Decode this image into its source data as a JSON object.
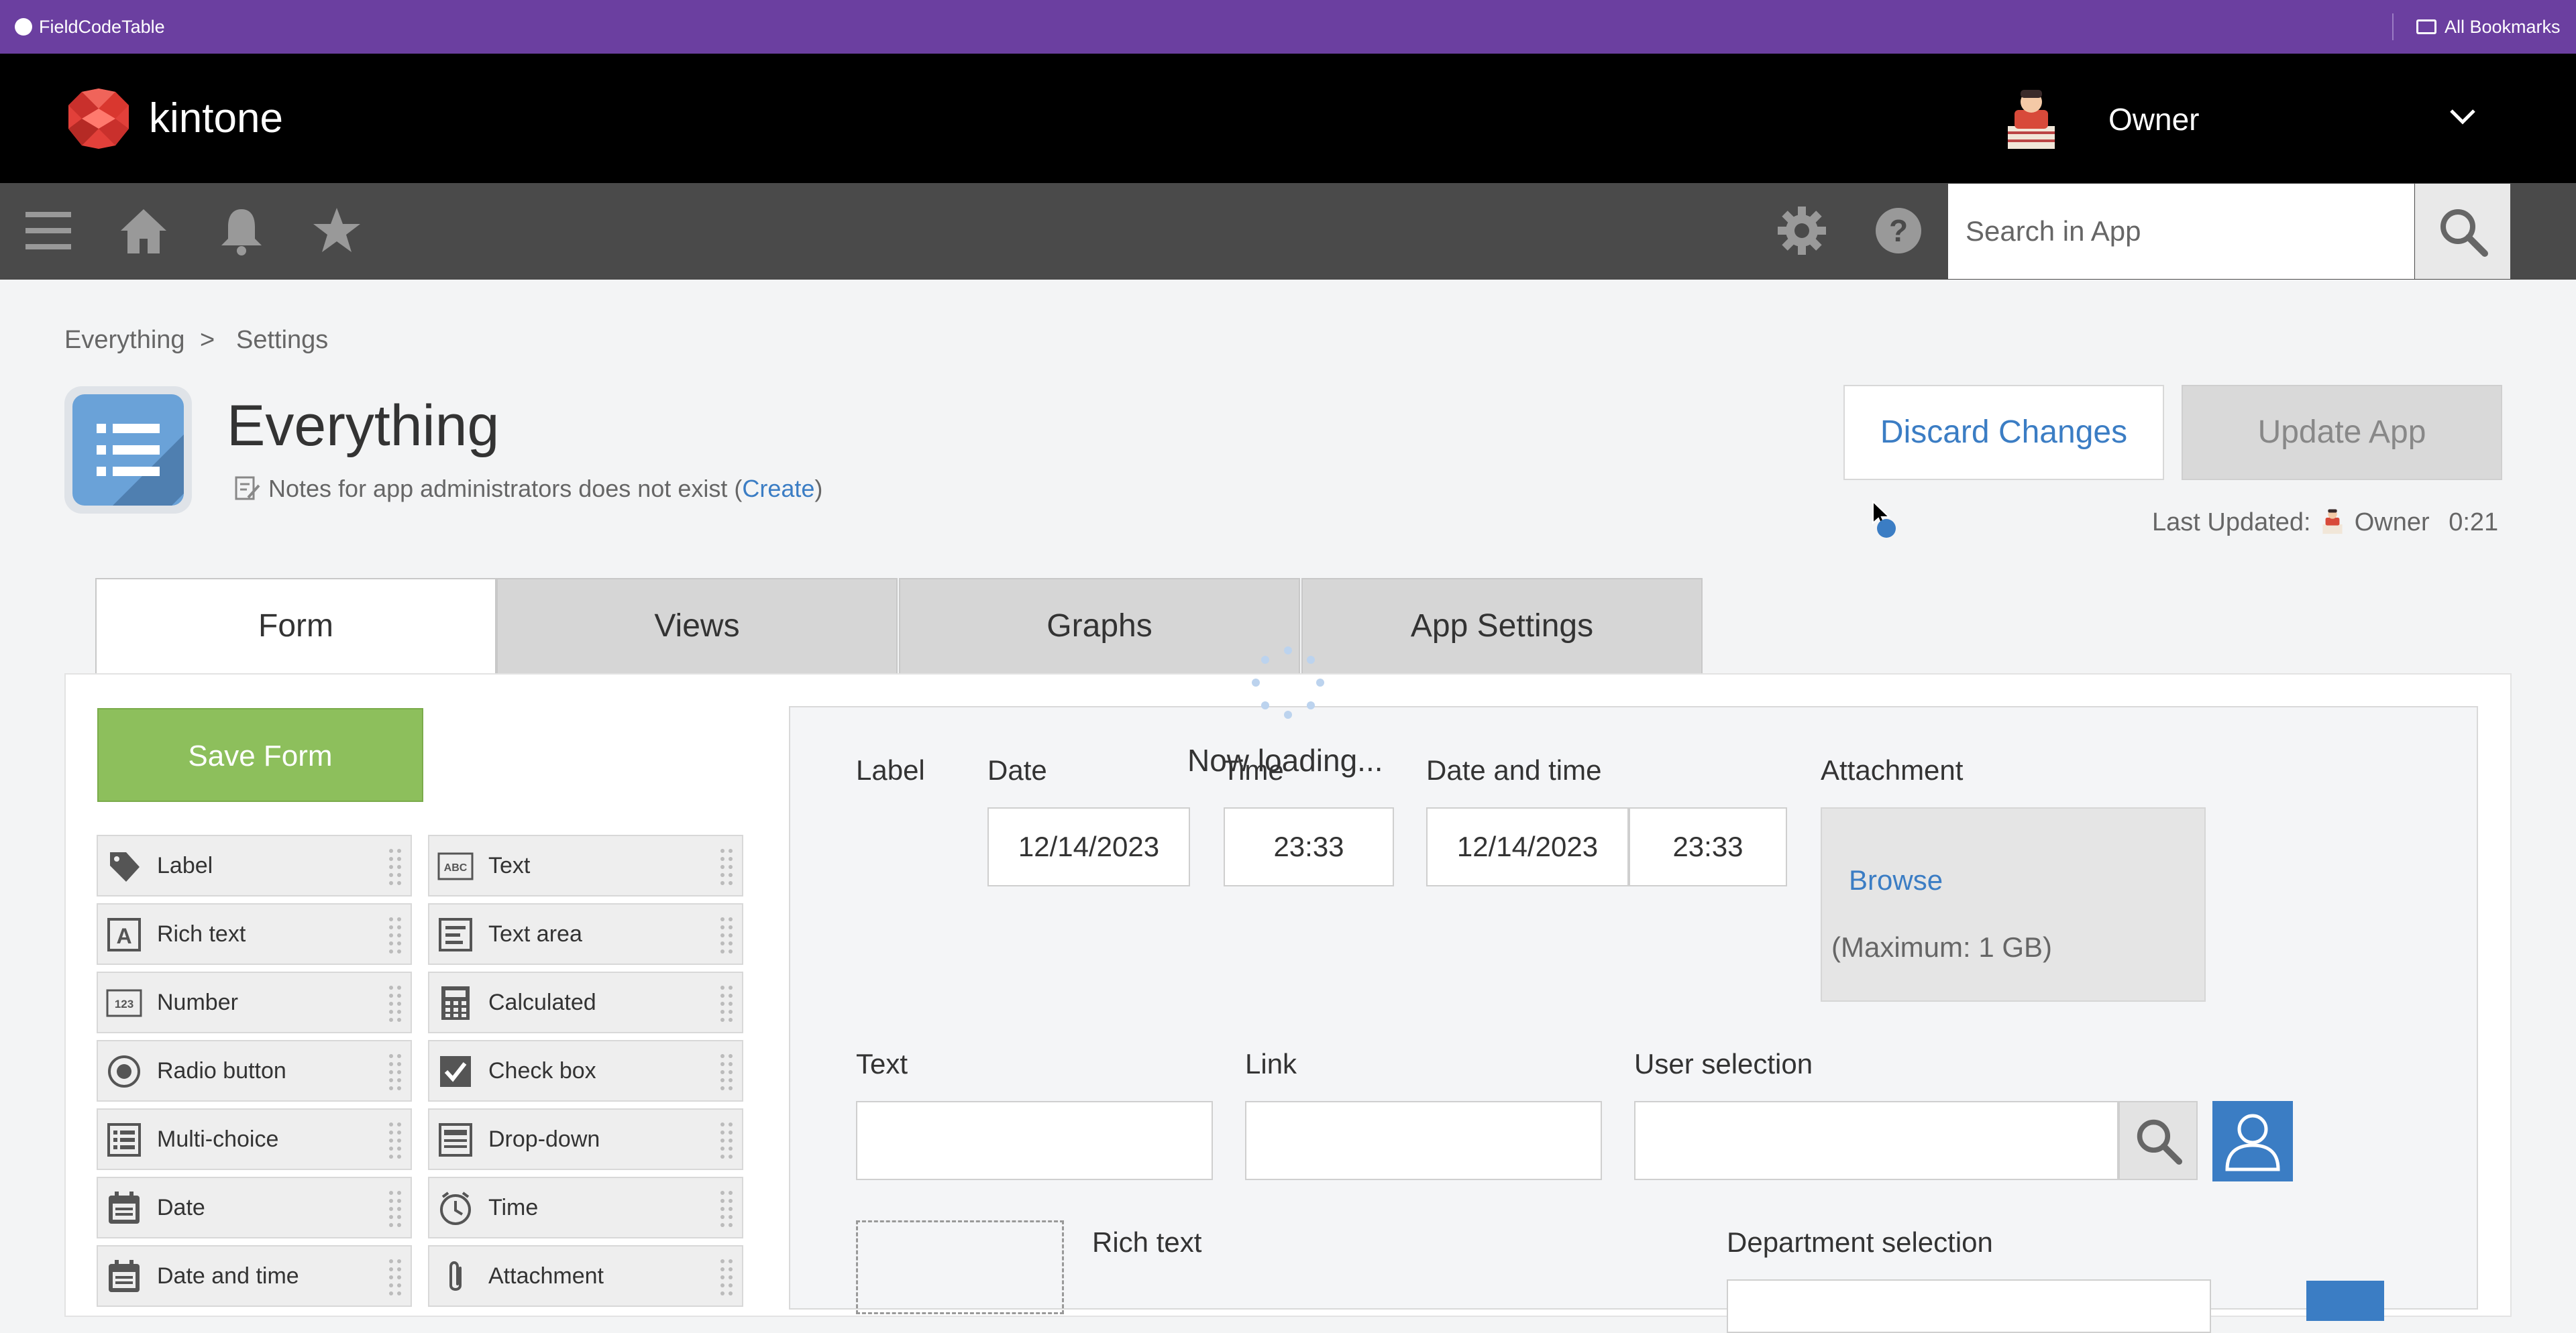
{
  "browser": {
    "tab_title": "FieldCodeTable",
    "bookmarks_label": "All Bookmarks"
  },
  "header": {
    "logo_text": "kintone",
    "user_name": "Owner"
  },
  "nav": {
    "search_placeholder": "Search in App"
  },
  "breadcrumb": {
    "items": [
      "Everything",
      "Settings"
    ],
    "separator": ">"
  },
  "app": {
    "title": "Everything",
    "notes_text": "Notes for app administrators does not exist (",
    "notes_link": "Create",
    "notes_close": ")"
  },
  "actions": {
    "discard_label": "Discard Changes",
    "update_label": "Update App"
  },
  "last_updated": {
    "label": "Last Updated:",
    "user": "Owner",
    "time": "0:21"
  },
  "tabs": [
    {
      "label": "Form",
      "active": true
    },
    {
      "label": "Views",
      "active": false
    },
    {
      "label": "Graphs",
      "active": false
    },
    {
      "label": "App Settings",
      "active": false
    }
  ],
  "palette": {
    "save_label": "Save Form",
    "items": [
      {
        "label": "Label",
        "icon": "tag-icon"
      },
      {
        "label": "Text",
        "icon": "abc-icon"
      },
      {
        "label": "Rich text",
        "icon": "rich-text-icon"
      },
      {
        "label": "Text area",
        "icon": "text-area-icon"
      },
      {
        "label": "Number",
        "icon": "number-icon"
      },
      {
        "label": "Calculated",
        "icon": "calculator-icon"
      },
      {
        "label": "Radio button",
        "icon": "radio-icon"
      },
      {
        "label": "Check box",
        "icon": "checkbox-icon"
      },
      {
        "label": "Multi-choice",
        "icon": "multi-choice-icon"
      },
      {
        "label": "Drop-down",
        "icon": "dropdown-icon"
      },
      {
        "label": "Date",
        "icon": "calendar-icon"
      },
      {
        "label": "Time",
        "icon": "clock-icon"
      },
      {
        "label": "Date and time",
        "icon": "calendar-icon"
      },
      {
        "label": "Attachment",
        "icon": "paperclip-icon"
      }
    ]
  },
  "canvas": {
    "loading_text": "Now loading...",
    "row1": {
      "label_field": "Label",
      "date_label": "Date",
      "date_value": "12/14/2023",
      "time_label": "Time",
      "time_value": "23:33",
      "datetime_label": "Date and time",
      "datetime_date": "12/14/2023",
      "datetime_time": "23:33",
      "attachment_label": "Attachment",
      "browse_label": "Browse",
      "max_label": "(Maximum: 1 GB)"
    },
    "row2": {
      "text_label": "Text",
      "link_label": "Link",
      "user_label": "User selection"
    },
    "row3": {
      "rich_text_label": "Rich text",
      "dept_label": "Department selection"
    }
  },
  "colors": {
    "browser_bar": "#6b3fa0",
    "save_green": "#8dbf5c",
    "link_blue": "#3b7dc4",
    "header_black": "#000000",
    "nav_gray": "#4a4a4a"
  }
}
